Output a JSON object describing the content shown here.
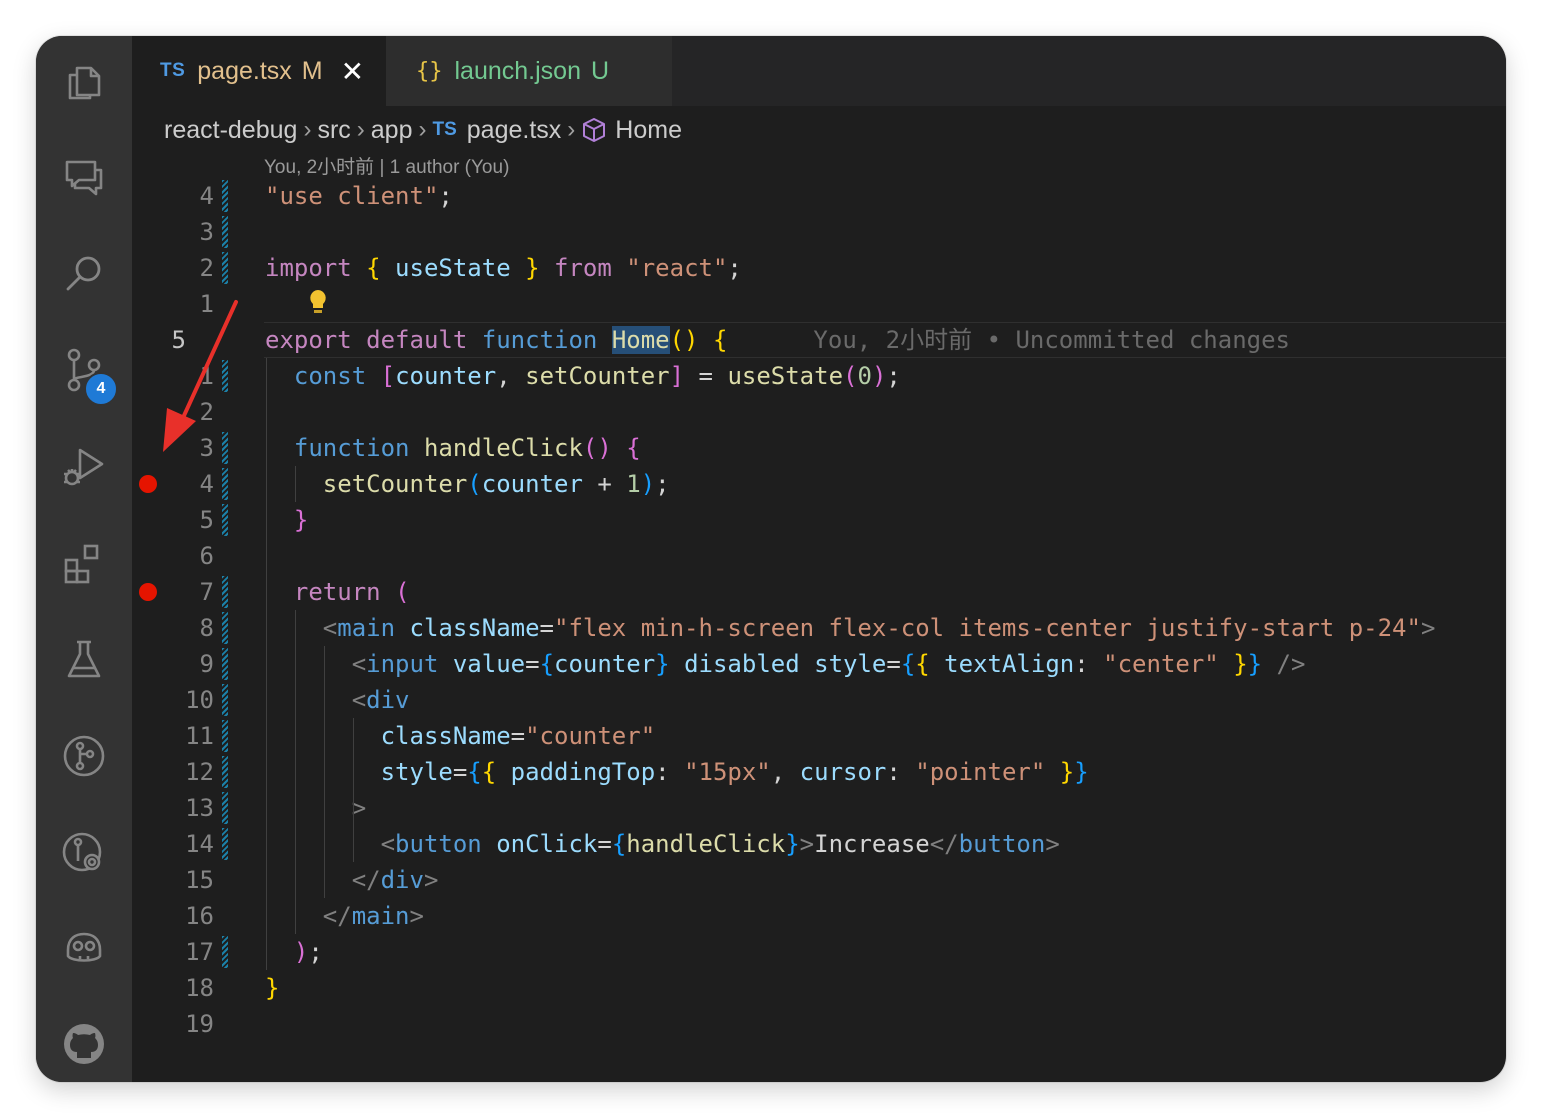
{
  "tabs": [
    {
      "lang_badge": "TS",
      "name": "page.tsx",
      "status": "M",
      "close": "✕"
    },
    {
      "lang_badge": "{}",
      "name": "launch.json",
      "status": "U"
    }
  ],
  "breadcrumb": {
    "items": [
      "react-debug",
      "src",
      "app"
    ],
    "file_badge": "TS",
    "file": "page.tsx",
    "symbol": "Home",
    "separator": "›"
  },
  "blame_header": "You, 2小时前 | 1 author (You)",
  "activity_bar": {
    "icons": [
      "explorer-icon",
      "chat-icon",
      "search-icon",
      "source-control-icon",
      "run-debug-icon",
      "extensions-icon",
      "testing-icon",
      "git-graph-icon",
      "git-lens-icon",
      "copilot-icon",
      "github-icon"
    ],
    "source_control_badge": "4"
  },
  "editor": {
    "line_numbers": [
      "4",
      "3",
      "2",
      "1",
      "5",
      "1",
      "2",
      "3",
      "4",
      "5",
      "6",
      "7",
      "8",
      "9",
      "10",
      "11",
      "12",
      "13",
      "14",
      "15",
      "16",
      "17",
      "18",
      "19"
    ],
    "current_line_index": 4,
    "breakpoint_lines": [
      8,
      11
    ],
    "inline_blame": "You, 2小时前 • Uncommitted changes",
    "lines": [
      [
        [
          "\"use client\"",
          "str"
        ],
        [
          ";",
          "pun"
        ]
      ],
      [],
      [
        [
          "import",
          "kw"
        ],
        [
          " ",
          "pun"
        ],
        [
          "{",
          "b1"
        ],
        [
          " useState ",
          "var"
        ],
        [
          "}",
          "b1"
        ],
        [
          " ",
          "pun"
        ],
        [
          "from",
          "kw"
        ],
        [
          " ",
          "pun"
        ],
        [
          "\"react\"",
          "str"
        ],
        [
          ";",
          "pun"
        ]
      ],
      [],
      [
        [
          "export",
          "kw"
        ],
        [
          " ",
          "pun"
        ],
        [
          "default",
          "kw"
        ],
        [
          " ",
          "pun"
        ],
        [
          "function",
          "kwb"
        ],
        [
          " ",
          "pun"
        ],
        [
          "Home",
          "fnhl"
        ],
        [
          "()",
          "b1"
        ],
        [
          " ",
          "pun"
        ],
        [
          "{",
          "b1"
        ]
      ],
      [
        [
          "  ",
          "pun"
        ],
        [
          "const",
          "kwb"
        ],
        [
          " ",
          "pun"
        ],
        [
          "[",
          "b2"
        ],
        [
          "counter",
          "var"
        ],
        [
          ", ",
          "pun"
        ],
        [
          "setCounter",
          "fn"
        ],
        [
          "]",
          "b2"
        ],
        [
          " = ",
          "pun"
        ],
        [
          "useState",
          "fn"
        ],
        [
          "(",
          "b2"
        ],
        [
          "0",
          "num"
        ],
        [
          ")",
          "b2"
        ],
        [
          ";",
          "pun"
        ]
      ],
      [],
      [
        [
          "  ",
          "pun"
        ],
        [
          "function",
          "kwb"
        ],
        [
          " ",
          "pun"
        ],
        [
          "handleClick",
          "fn"
        ],
        [
          "()",
          "b2"
        ],
        [
          " ",
          "pun"
        ],
        [
          "{",
          "b2"
        ]
      ],
      [
        [
          "    ",
          "pun"
        ],
        [
          "setCounter",
          "fn"
        ],
        [
          "(",
          "b3"
        ],
        [
          "counter",
          "var"
        ],
        [
          " + ",
          "pun"
        ],
        [
          "1",
          "num"
        ],
        [
          ")",
          "b3"
        ],
        [
          ";",
          "pun"
        ]
      ],
      [
        [
          "  ",
          "pun"
        ],
        [
          "}",
          "b2"
        ]
      ],
      [],
      [
        [
          "  ",
          "pun"
        ],
        [
          "return",
          "kw"
        ],
        [
          " ",
          "pun"
        ],
        [
          "(",
          "b2"
        ]
      ],
      [
        [
          "    ",
          "pun"
        ],
        [
          "<",
          "tagp"
        ],
        [
          "main",
          "tag"
        ],
        [
          " ",
          "pun"
        ],
        [
          "className",
          "attr"
        ],
        [
          "=",
          "pun"
        ],
        [
          "\"flex min-h-screen flex-col items-center justify-start p-24\"",
          "str"
        ],
        [
          ">",
          "tagp"
        ]
      ],
      [
        [
          "      ",
          "pun"
        ],
        [
          "<",
          "tagp"
        ],
        [
          "input",
          "tag"
        ],
        [
          " ",
          "pun"
        ],
        [
          "value",
          "attr"
        ],
        [
          "=",
          "pun"
        ],
        [
          "{",
          "b3"
        ],
        [
          "counter",
          "var"
        ],
        [
          "}",
          "b3"
        ],
        [
          " ",
          "pun"
        ],
        [
          "disabled",
          "attr"
        ],
        [
          " ",
          "pun"
        ],
        [
          "style",
          "attr"
        ],
        [
          "=",
          "pun"
        ],
        [
          "{",
          "b3"
        ],
        [
          "{",
          "b1"
        ],
        [
          " textAlign",
          "var"
        ],
        [
          ": ",
          "pun"
        ],
        [
          "\"center\"",
          "str"
        ],
        [
          " ",
          "pun"
        ],
        [
          "}",
          "b1"
        ],
        [
          "}",
          "b3"
        ],
        [
          " ",
          "pun"
        ],
        [
          "/>",
          "tagp"
        ]
      ],
      [
        [
          "      ",
          "pun"
        ],
        [
          "<",
          "tagp"
        ],
        [
          "div",
          "tag"
        ]
      ],
      [
        [
          "        ",
          "pun"
        ],
        [
          "className",
          "attr"
        ],
        [
          "=",
          "pun"
        ],
        [
          "\"counter\"",
          "str"
        ]
      ],
      [
        [
          "        ",
          "pun"
        ],
        [
          "style",
          "attr"
        ],
        [
          "=",
          "pun"
        ],
        [
          "{",
          "b3"
        ],
        [
          "{",
          "b1"
        ],
        [
          " paddingTop",
          "var"
        ],
        [
          ": ",
          "pun"
        ],
        [
          "\"15px\"",
          "str"
        ],
        [
          ", ",
          "pun"
        ],
        [
          "cursor",
          "var"
        ],
        [
          ": ",
          "pun"
        ],
        [
          "\"pointer\"",
          "str"
        ],
        [
          " ",
          "pun"
        ],
        [
          "}",
          "b1"
        ],
        [
          "}",
          "b3"
        ]
      ],
      [
        [
          "      ",
          "pun"
        ],
        [
          ">",
          "tagp"
        ]
      ],
      [
        [
          "        ",
          "pun"
        ],
        [
          "<",
          "tagp"
        ],
        [
          "button",
          "tag"
        ],
        [
          " ",
          "pun"
        ],
        [
          "onClick",
          "attr"
        ],
        [
          "=",
          "pun"
        ],
        [
          "{",
          "b3"
        ],
        [
          "handleClick",
          "fn"
        ],
        [
          "}",
          "b3"
        ],
        [
          ">",
          "tagp"
        ],
        [
          "Increase",
          "pun"
        ],
        [
          "</",
          "tagp"
        ],
        [
          "button",
          "tag"
        ],
        [
          ">",
          "tagp"
        ]
      ],
      [
        [
          "      ",
          "pun"
        ],
        [
          "</",
          "tagp"
        ],
        [
          "div",
          "tag"
        ],
        [
          ">",
          "tagp"
        ]
      ],
      [
        [
          "    ",
          "pun"
        ],
        [
          "</",
          "tagp"
        ],
        [
          "main",
          "tag"
        ],
        [
          ">",
          "tagp"
        ]
      ],
      [
        [
          "  ",
          "pun"
        ],
        [
          ")",
          "b2"
        ],
        [
          ";",
          "pun"
        ]
      ],
      [
        [
          "}",
          "b1"
        ]
      ],
      []
    ]
  },
  "colors": {
    "breakpoint": "#e51400",
    "modified_tab": "#e2c08d",
    "untracked_tab": "#73c991",
    "annotation_arrow": "#e8302a"
  }
}
